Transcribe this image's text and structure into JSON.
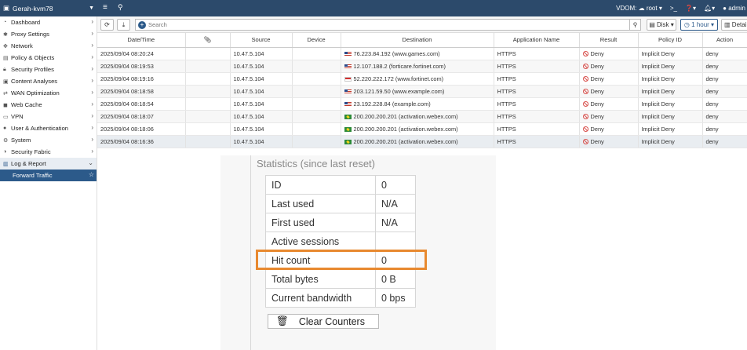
{
  "header": {
    "device_name": "Gerah-kvm78",
    "vdom_label": "VDOM:",
    "vdom_value": "root",
    "user": "admin"
  },
  "sidebar": {
    "items": [
      {
        "label": "Dashboard"
      },
      {
        "label": "Proxy Settings"
      },
      {
        "label": "Network"
      },
      {
        "label": "Policy & Objects"
      },
      {
        "label": "Security Profiles"
      },
      {
        "label": "Content Analyses"
      },
      {
        "label": "WAN Optimization"
      },
      {
        "label": "Web Cache"
      },
      {
        "label": "VPN"
      },
      {
        "label": "User & Authentication"
      },
      {
        "label": "System"
      },
      {
        "label": "Security Fabric"
      },
      {
        "label": "Log & Report"
      },
      {
        "label": "Forward Traffic"
      }
    ]
  },
  "toolbar": {
    "search_placeholder": "Search",
    "disk_label": "Disk",
    "time_label": "1 hour",
    "details_label": "Details"
  },
  "table": {
    "columns": [
      "Date/Time",
      "",
      "Source",
      "Device",
      "Destination",
      "Application Name",
      "Result",
      "Policy ID",
      "Action"
    ],
    "rows": [
      {
        "datetime": "2025/09/04 08:20:24",
        "source": "10.47.5.104",
        "flag": "us",
        "destination": "76.223.84.192 (www.games.com)",
        "app": "HTTPS",
        "result": "Deny",
        "policy": "Implicit Deny",
        "action": "deny"
      },
      {
        "datetime": "2025/09/04 08:19:53",
        "source": "10.47.5.104",
        "flag": "us",
        "destination": "12.107.188.2 (forticare.fortinet.com)",
        "app": "HTTPS",
        "result": "Deny",
        "policy": "Implicit Deny",
        "action": "deny"
      },
      {
        "datetime": "2025/09/04 08:19:16",
        "source": "10.47.5.104",
        "flag": "sg",
        "destination": "52.220.222.172 (www.fortinet.com)",
        "app": "HTTPS",
        "result": "Deny",
        "policy": "Implicit Deny",
        "action": "deny"
      },
      {
        "datetime": "2025/09/04 08:18:58",
        "source": "10.47.5.104",
        "flag": "us",
        "destination": "203.121.59.50 (www.example.com)",
        "app": "HTTPS",
        "result": "Deny",
        "policy": "Implicit Deny",
        "action": "deny"
      },
      {
        "datetime": "2025/09/04 08:18:54",
        "source": "10.47.5.104",
        "flag": "us",
        "destination": "23.192.228.84 (example.com)",
        "app": "HTTPS",
        "result": "Deny",
        "policy": "Implicit Deny",
        "action": "deny"
      },
      {
        "datetime": "2025/09/04 08:18:07",
        "source": "10.47.5.104",
        "flag": "br",
        "destination": "200.200.200.201 (activation.webex.com)",
        "app": "HTTPS",
        "result": "Deny",
        "policy": "Implicit Deny",
        "action": "deny"
      },
      {
        "datetime": "2025/09/04 08:18:06",
        "source": "10.47.5.104",
        "flag": "br",
        "destination": "200.200.200.201 (activation.webex.com)",
        "app": "HTTPS",
        "result": "Deny",
        "policy": "Implicit Deny",
        "action": "deny"
      },
      {
        "datetime": "2025/09/04 08:16:36",
        "source": "10.47.5.104",
        "flag": "br",
        "destination": "200.200.200.201 (activation.webex.com)",
        "app": "HTTPS",
        "result": "Deny",
        "policy": "Implicit Deny",
        "action": "deny"
      }
    ]
  },
  "stats": {
    "title": "Statistics (since last reset)",
    "rows": [
      {
        "label": "ID",
        "value": "0"
      },
      {
        "label": "Last used",
        "value": "N/A"
      },
      {
        "label": "First used",
        "value": "N/A"
      },
      {
        "label": "Active sessions",
        "value": ""
      },
      {
        "label": "Hit count",
        "value": "0"
      },
      {
        "label": "Total bytes",
        "value": "0 B"
      },
      {
        "label": "Current bandwidth",
        "value": "0 bps"
      }
    ],
    "clear_button": "Clear Counters"
  },
  "colors": {
    "header_bg": "#2c4a6b",
    "active_item": "#2c5a8a",
    "highlight": "#e8892f",
    "deny": "#d9534f"
  }
}
